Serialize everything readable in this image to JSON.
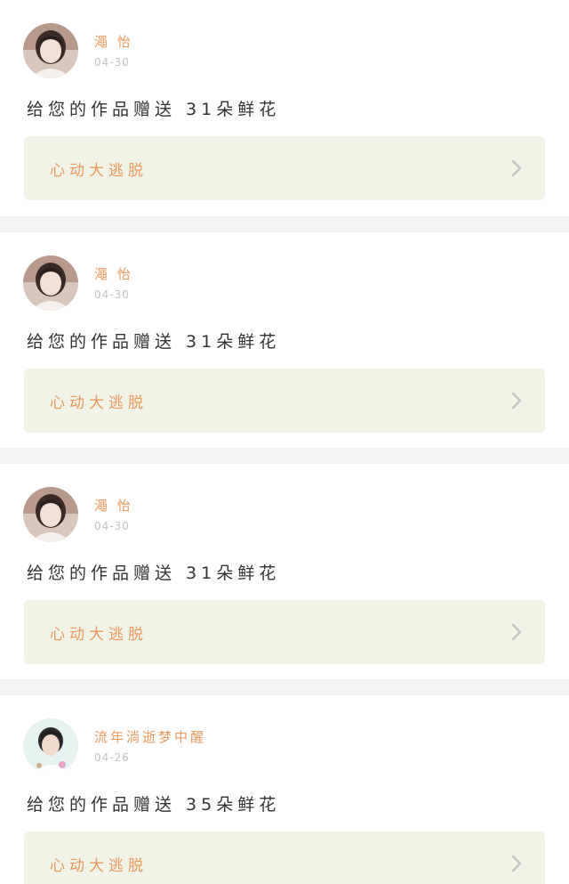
{
  "header": {
    "active_tab_indicator_color": "#e8669a"
  },
  "colors": {
    "accent_text": "#e89a5f",
    "card_link_bg": "#f1f3e6",
    "page_bg": "#f4f4f4"
  },
  "notifications": [
    {
      "avatar_icon": "user-photo-girl-icon",
      "name": "澠 怡",
      "time": "04-30",
      "message": "给您的作品赠送 31朵鲜花",
      "work_title": "心动大逃脱"
    },
    {
      "avatar_icon": "user-photo-girl-icon",
      "name": "澠 怡",
      "time": "04-30",
      "message": "给您的作品赠送 31朵鲜花",
      "work_title": "心动大逃脱"
    },
    {
      "avatar_icon": "user-photo-girl-icon",
      "name": "澠 怡",
      "time": "04-30",
      "message": "给您的作品赠送 31朵鲜花",
      "work_title": "心动大逃脱"
    },
    {
      "avatar_icon": "user-photo-boy-icon",
      "name": "流年淌逝梦中醒",
      "time": "04-26",
      "message": "给您的作品赠送 35朵鲜花",
      "work_title": "心动大逃脱"
    }
  ]
}
